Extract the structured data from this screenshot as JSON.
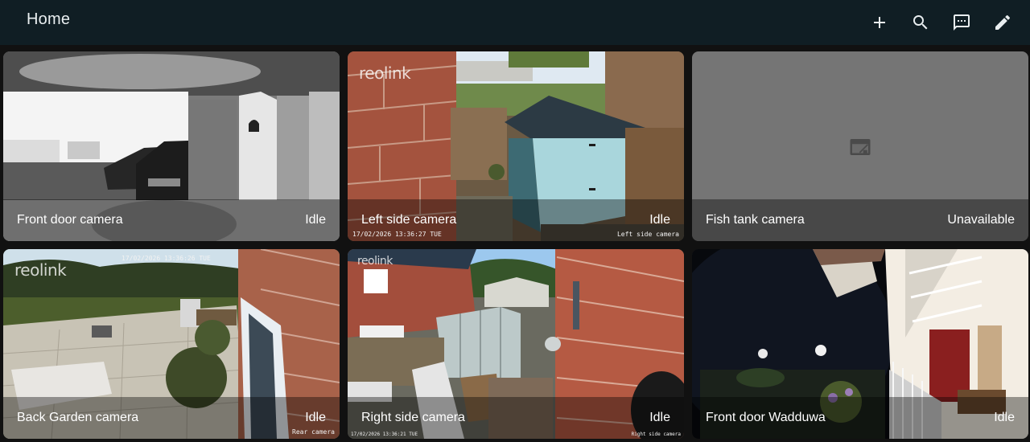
{
  "header": {
    "title": "Home",
    "actions": [
      {
        "icon": "plus-icon"
      },
      {
        "icon": "search-icon"
      },
      {
        "icon": "message-icon"
      },
      {
        "icon": "pencil-icon"
      }
    ]
  },
  "cameras": [
    {
      "name": "Front door camera",
      "state": "Idle"
    },
    {
      "name": "Left side camera",
      "state": "Idle",
      "logo": "reolink",
      "timestamp": "17/02/2026 13:36:27 TUE",
      "overlay_label": "Left side camera"
    },
    {
      "name": "Fish tank camera",
      "state": "Unavailable"
    },
    {
      "name": "Back Garden camera",
      "state": "Idle",
      "logo": "reolink",
      "timestamp": "17/02/2026 13:36:26 TUE",
      "overlay_label": "Rear camera"
    },
    {
      "name": "Right side camera",
      "state": "Idle",
      "logo": "reolink",
      "timestamp": "17/02/2026 13:36:21 TUE",
      "overlay_label": "Right side camera"
    },
    {
      "name": "Front door Wadduwa",
      "state": "Idle"
    }
  ],
  "colors": {
    "header_bg": "#101e24",
    "page_bg": "#111111",
    "unavailable_bg": "#757575"
  }
}
